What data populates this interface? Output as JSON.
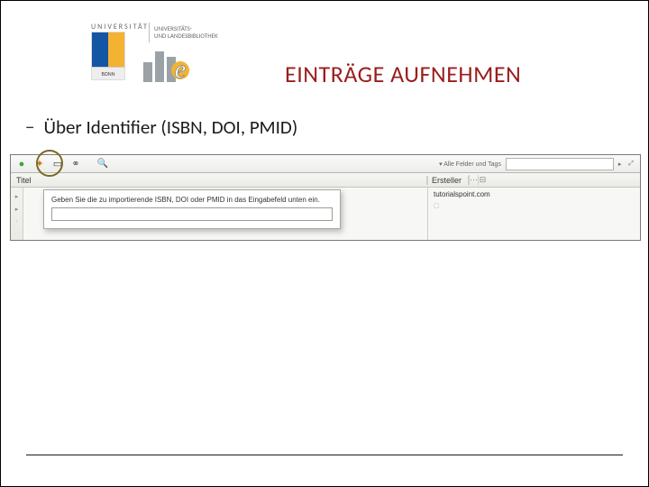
{
  "header": {
    "uni_label": "UNIVERSITÄT",
    "uni_name": "BONN",
    "ulb_line1": "UNIVERSITÄTS-",
    "ulb_line2": "UND LANDESBIBLIOTHEK",
    "ulb_glyph": "e"
  },
  "title": "EINTRÄGE AUFNEHMEN",
  "bullet": {
    "dash": "−",
    "text": "Über Identifier (ISBN, DOI, PMID)"
  },
  "shot": {
    "search_dropdown": "Alle Felder und Tags",
    "search_placeholder": "",
    "col_title": "Titel",
    "col_ersteller": "Ersteller",
    "right_value": "tutorialspoint.com",
    "popover_msg": "Geben Sie die zu importierende ISBN, DOI oder PMID in das Eingabefeld unten ein.",
    "popover_value": ""
  }
}
